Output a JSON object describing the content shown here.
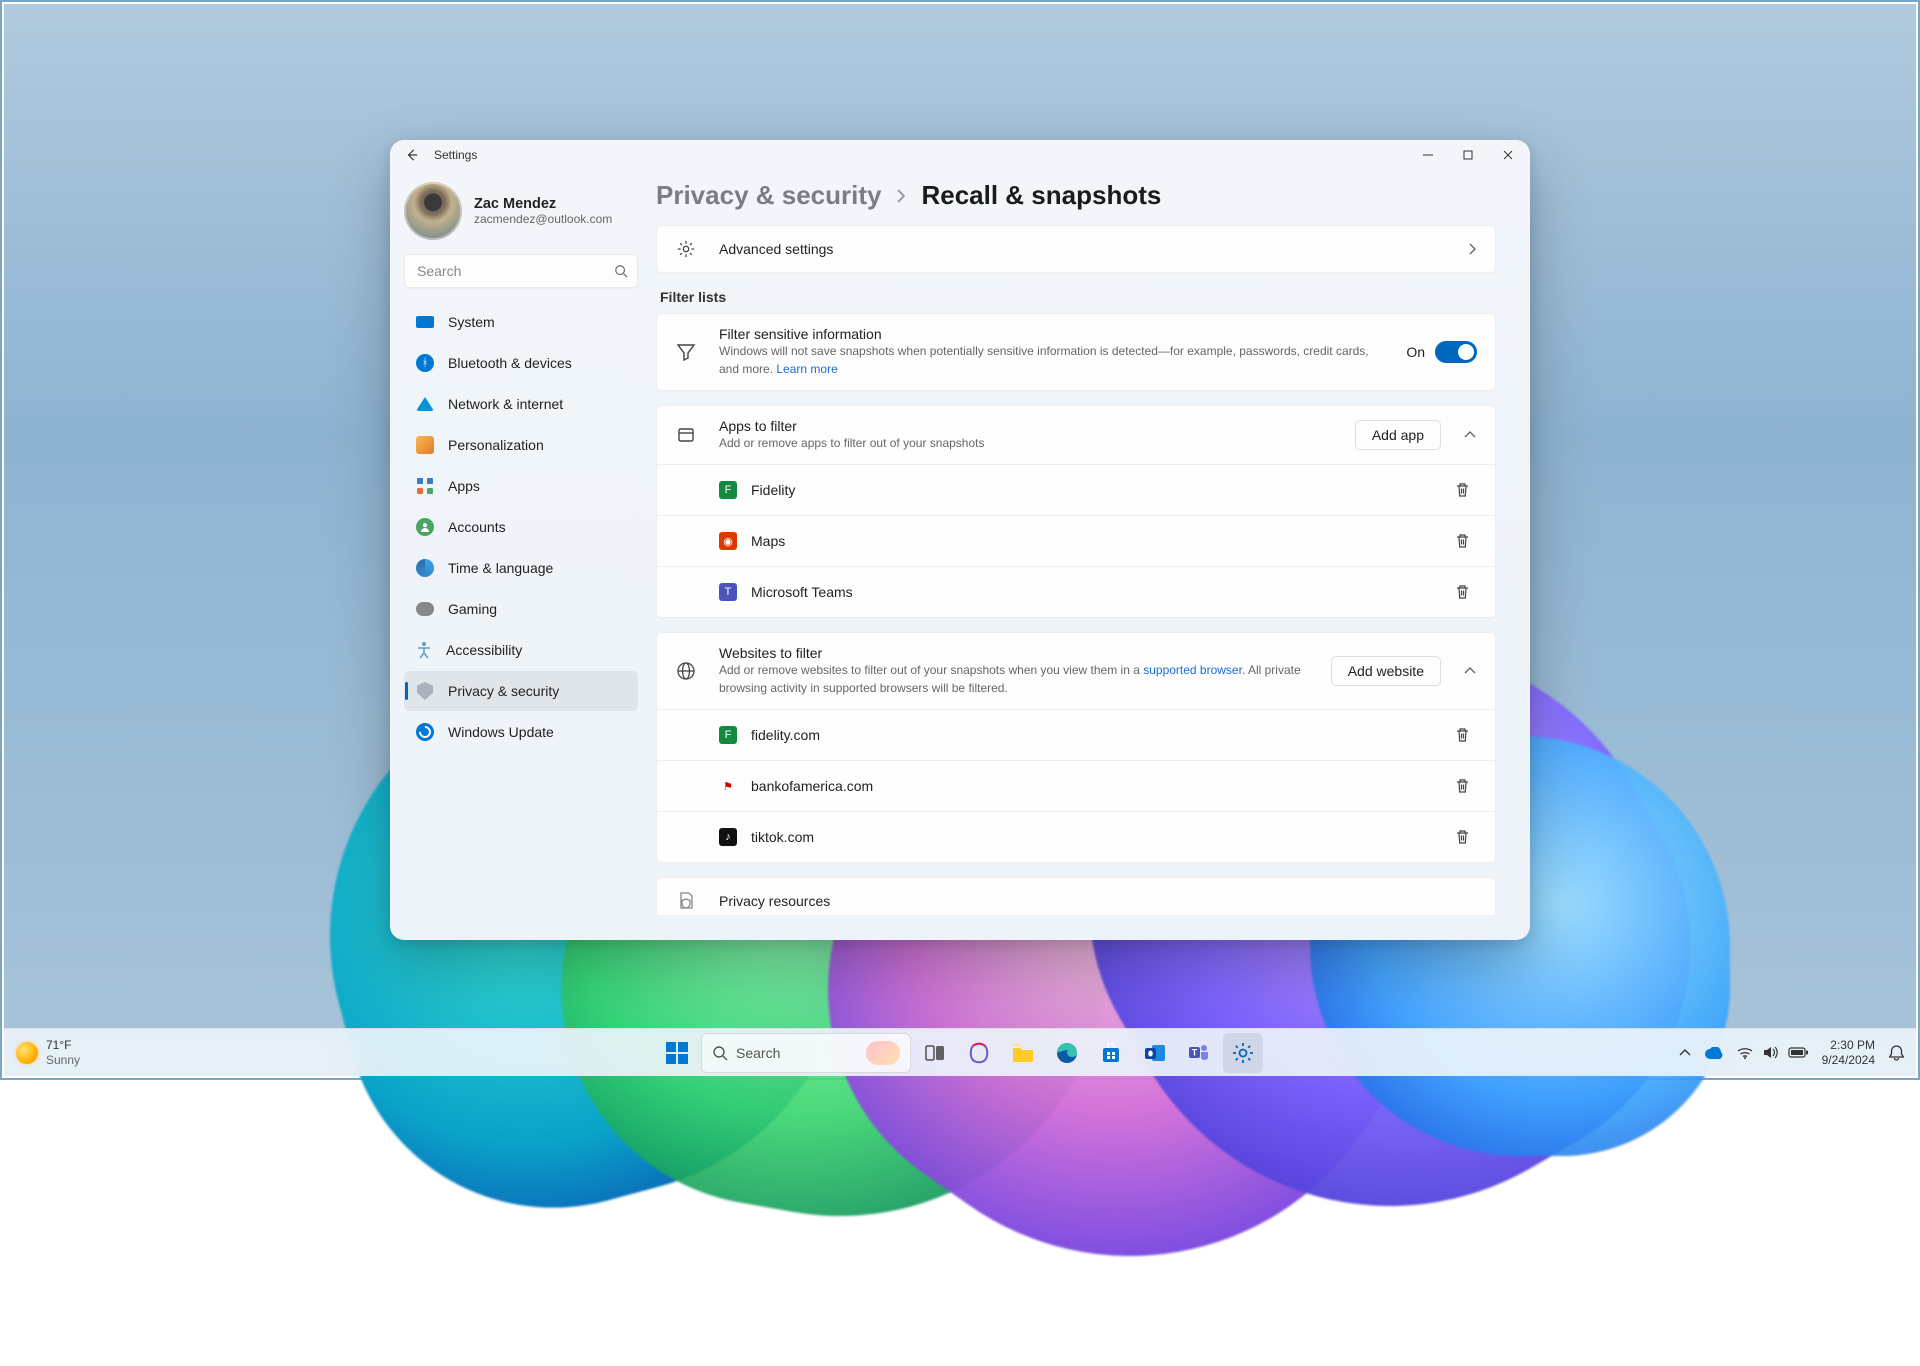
{
  "window": {
    "title": "Settings"
  },
  "profile": {
    "name": "Zac Mendez",
    "email": "zacmendez@outlook.com"
  },
  "search": {
    "placeholder": "Search"
  },
  "sidebar": {
    "items": [
      {
        "id": "system",
        "label": "System"
      },
      {
        "id": "bluetooth",
        "label": "Bluetooth & devices"
      },
      {
        "id": "network",
        "label": "Network & internet"
      },
      {
        "id": "personal",
        "label": "Personalization"
      },
      {
        "id": "apps",
        "label": "Apps"
      },
      {
        "id": "accounts",
        "label": "Accounts"
      },
      {
        "id": "time",
        "label": "Time & language"
      },
      {
        "id": "gaming",
        "label": "Gaming"
      },
      {
        "id": "accessibility",
        "label": "Accessibility"
      },
      {
        "id": "privacy",
        "label": "Privacy & security"
      },
      {
        "id": "update",
        "label": "Windows Update"
      }
    ]
  },
  "breadcrumb": {
    "parent": "Privacy & security",
    "current": "Recall & snapshots"
  },
  "advanced": {
    "label": "Advanced settings"
  },
  "section_filter_lists": "Filter lists",
  "filter_sensitive": {
    "title": "Filter sensitive information",
    "subtitle_prefix": "Windows will not save snapshots when potentially sensitive information is detected—for example, passwords, credit cards, and more. ",
    "learn_more": "Learn more",
    "state_label": "On",
    "state": true
  },
  "apps_to_filter": {
    "title": "Apps to filter",
    "subtitle": "Add or remove apps to filter out of your snapshots",
    "add_label": "Add app",
    "items": [
      {
        "label": "Fidelity",
        "icon_color": "#128a40"
      },
      {
        "label": "Maps",
        "icon_color": "#d83b01"
      },
      {
        "label": "Microsoft Teams",
        "icon_color": "#4b53bc"
      }
    ]
  },
  "websites_to_filter": {
    "title": "Websites to filter",
    "subtitle_prefix": "Add or remove websites to filter out of your snapshots when you view them in a ",
    "supported_link": "supported browser",
    "subtitle_suffix": ". All private browsing activity in supported browsers will be filtered.",
    "add_label": "Add website",
    "items": [
      {
        "label": "fidelity.com",
        "icon_color": "#128a40"
      },
      {
        "label": "bankofamerica.com",
        "icon_color": "#cc0000"
      },
      {
        "label": "tiktok.com",
        "icon_color": "#111111"
      }
    ]
  },
  "privacy_resources": {
    "title": "Privacy resources"
  },
  "taskbar": {
    "weather": {
      "temp": "71°F",
      "condition": "Sunny"
    },
    "search_placeholder": "Search",
    "time": "2:30 PM",
    "date": "9/24/2024"
  }
}
